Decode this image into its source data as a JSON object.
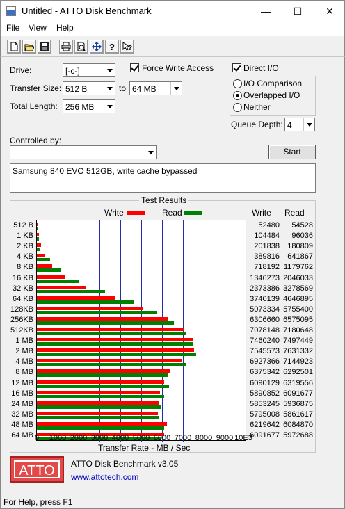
{
  "window": {
    "title": "Untitled - ATTO Disk Benchmark",
    "minimize": "—",
    "maximize": "☐",
    "close": "✕"
  },
  "menu": [
    "File",
    "View",
    "Help"
  ],
  "toolbar": [
    "new-icon",
    "open-icon",
    "save-icon",
    "print-icon",
    "print-preview-icon",
    "move-icon",
    "help-icon",
    "context-help-icon"
  ],
  "settings": {
    "drive_label": "Drive:",
    "drive_value": "[-c-]",
    "transfer_size_label": "Transfer Size:",
    "transfer_from": "512 B",
    "to_label": "to",
    "transfer_to": "64 MB",
    "total_length_label": "Total Length:",
    "total_length_value": "256 MB",
    "force_write_label": "Force Write Access",
    "force_write_checked": true,
    "direct_io_label": "Direct I/O",
    "direct_io_checked": true,
    "io_comparison_label": "I/O Comparison",
    "overlapped_io_label": "Overlapped I/O",
    "neither_label": "Neither",
    "selected_mode": "Overlapped I/O",
    "queue_depth_label": "Queue Depth:",
    "queue_depth_value": "4",
    "controlled_by_label": "Controlled by:",
    "controlled_by_value": "",
    "start_button": "Start",
    "description": "Samsung 840 EVO 512GB, write cache bypassed"
  },
  "results": {
    "group_title": "Test Results",
    "legend_write": "Write",
    "legend_read": "Read",
    "col_write": "Write",
    "col_read": "Read",
    "x_axis_label": "Transfer Rate - MB / Sec",
    "x_ticks": [
      "0",
      "1000",
      "2000",
      "3000",
      "4000",
      "5000",
      "6000",
      "7000",
      "8000",
      "9000",
      "10E3"
    ]
  },
  "chart_data": {
    "type": "bar",
    "orientation": "horizontal",
    "categories": [
      "512 B",
      "1 KB",
      "2 KB",
      "4 KB",
      "8 KB",
      "16 KB",
      "32 KB",
      "64 KB",
      "128KB",
      "256KB",
      "512KB",
      "1 MB",
      "2 MB",
      "4 MB",
      "8 MB",
      "12 MB",
      "16 MB",
      "24 MB",
      "32 MB",
      "48 MB",
      "64 MB"
    ],
    "series": [
      {
        "name": "Write",
        "color": "#ff0000",
        "values": [
          52480,
          104484,
          201838,
          389816,
          718192,
          1346273,
          2373386,
          3740139,
          5073334,
          6306660,
          7078148,
          7460240,
          7545573,
          6927366,
          6375342,
          6090129,
          5890852,
          5853245,
          5795008,
          6219642,
          6091677
        ]
      },
      {
        "name": "Read",
        "color": "#008000",
        "values": [
          54528,
          96036,
          180809,
          641867,
          1179762,
          2046033,
          3278569,
          4646895,
          5755400,
          6575095,
          7180648,
          7497449,
          7631332,
          7144923,
          6292501,
          6319556,
          6091677,
          5936875,
          5861617,
          6084870,
          5972688
        ]
      }
    ],
    "xlabel": "Transfer Rate - MB / Sec",
    "xlim": [
      0,
      10000
    ],
    "grid": true
  },
  "branding": {
    "logo_text": "ATTO",
    "logo_color": "#e24a4a",
    "product": "ATTO Disk Benchmark v3.05",
    "link": "www.attotech.com"
  },
  "status": "For Help, press F1"
}
